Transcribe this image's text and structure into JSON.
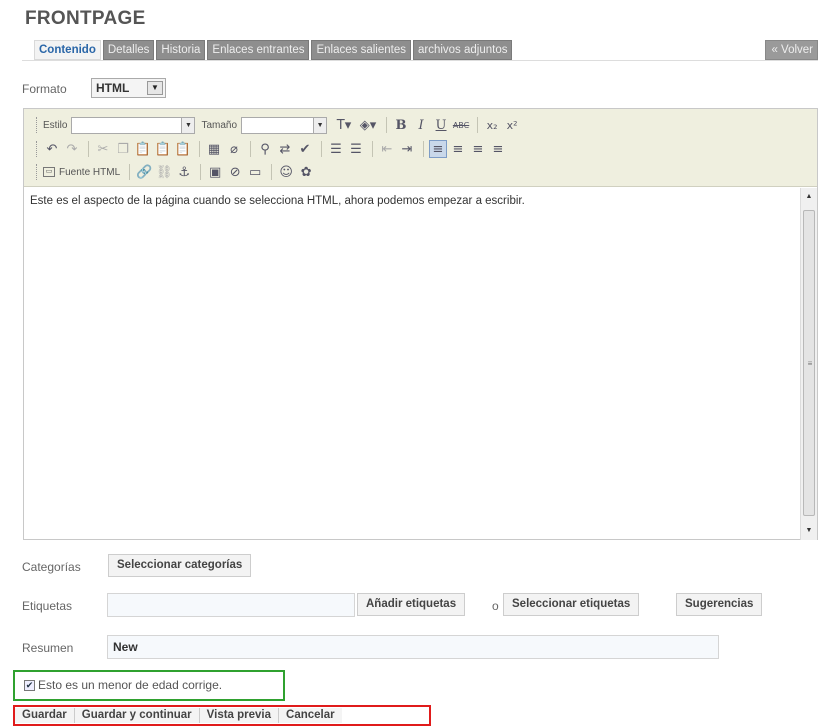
{
  "page": {
    "title": "FRONTPAGE"
  },
  "tabs": [
    {
      "label": "Contenido",
      "active": true
    },
    {
      "label": "Detalles"
    },
    {
      "label": "Historia"
    },
    {
      "label": "Enlaces entrantes"
    },
    {
      "label": "Enlaces salientes"
    },
    {
      "label": "archivos adjuntos"
    }
  ],
  "back_label": "« Volver",
  "format": {
    "label": "Formato",
    "value": "HTML"
  },
  "toolbar": {
    "style_label": "Estilo",
    "size_label": "Tamaño",
    "source_label": "Fuente HTML"
  },
  "editor": {
    "content": "Este es el aspecto de la página cuando se selecciona HTML, ahora podemos empezar a escribir."
  },
  "categories": {
    "label": "Categorías",
    "button": "Seleccionar categorías"
  },
  "tags": {
    "label": "Etiquetas",
    "input_value": "",
    "add_button": "Añadir etiquetas",
    "or_text": "o",
    "select_button": "Seleccionar etiquetas",
    "suggestions_button": "Sugerencias"
  },
  "summary": {
    "label": "Resumen",
    "value": "New"
  },
  "minor_checkbox": {
    "label": "Esto es un menor de edad corrige.",
    "checked": true
  },
  "actions": {
    "save": "Guardar",
    "save_continue": "Guardar y continuar",
    "preview": "Vista previa",
    "cancel": "Cancelar"
  },
  "colors": {
    "active_tab_text": "#2a66a8",
    "inactive_tab_bg": "#8e8e8e",
    "checkbox_highlight": "#2fa12f",
    "action_highlight": "#e01b1b",
    "toolbar_bg": "#efefdf"
  }
}
